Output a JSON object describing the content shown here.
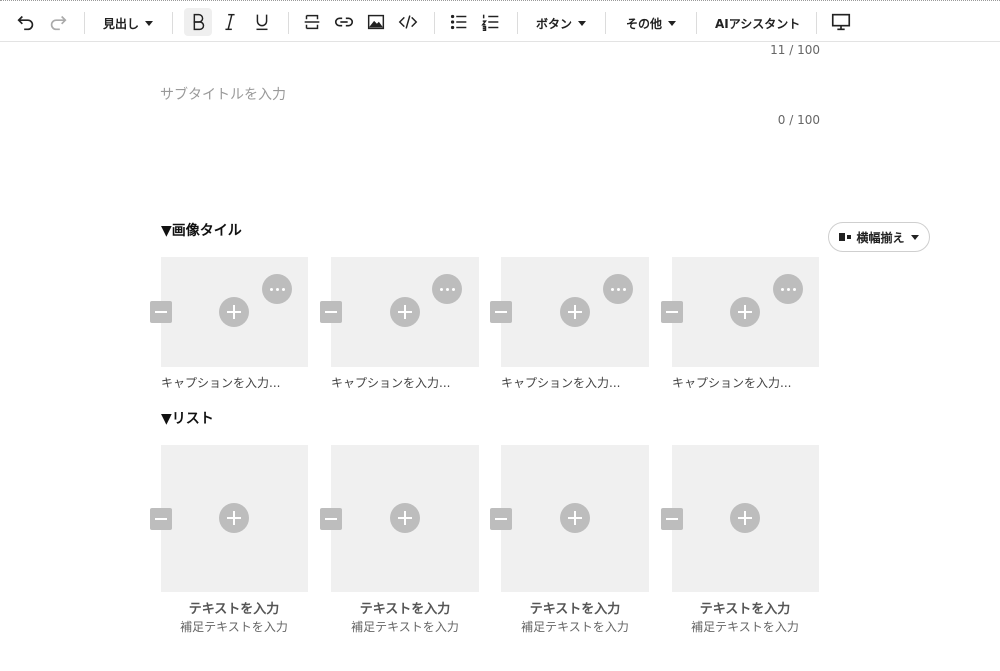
{
  "toolbar": {
    "heading_label": "見出し",
    "button_label": "ボタン",
    "other_label": "その他",
    "ai_label": "AIアシスタント"
  },
  "title": {
    "counter": "11 / 100"
  },
  "subtitle": {
    "placeholder": "サブタイトルを入力",
    "counter": "0 / 100"
  },
  "image_tiles": {
    "heading": "▼画像タイル",
    "align_label": "横幅揃え",
    "tiles": [
      {
        "caption": "キャプションを入力..."
      },
      {
        "caption": "キャプションを入力..."
      },
      {
        "caption": "キャプションを入力..."
      },
      {
        "caption": "キャプションを入力..."
      }
    ]
  },
  "list": {
    "heading": "▼リスト",
    "items": [
      {
        "title": "テキストを入力",
        "subtext": "補足テキストを入力"
      },
      {
        "title": "テキストを入力",
        "subtext": "補足テキストを入力"
      },
      {
        "title": "テキストを入力",
        "subtext": "補足テキストを入力"
      },
      {
        "title": "テキストを入力",
        "subtext": "補足テキストを入力"
      }
    ]
  },
  "icons": [
    "undo-icon",
    "redo-icon",
    "bold-icon",
    "italic-icon",
    "underline-icon",
    "strikethrough-icon",
    "link-icon",
    "image-icon",
    "code-icon",
    "bullet-list-icon",
    "numbered-list-icon",
    "preview-monitor-icon",
    "plus-icon",
    "more-icon",
    "minus-icon"
  ]
}
